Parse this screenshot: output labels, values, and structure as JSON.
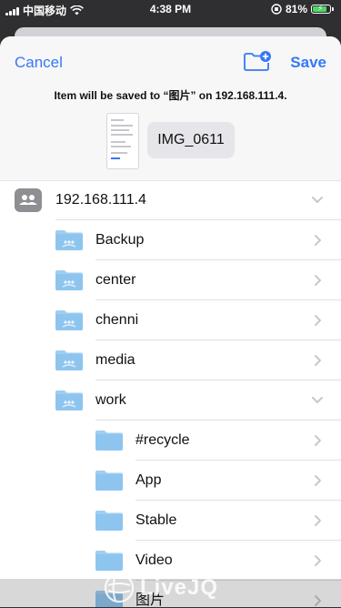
{
  "status_bar": {
    "carrier": "中国移动",
    "time": "4:38 PM",
    "battery_percent": "81%"
  },
  "header": {
    "cancel_label": "Cancel",
    "save_label": "Save",
    "save_message": "Item will be saved to “图片” on 192.168.111.4.",
    "file_name": "IMG_0611"
  },
  "server": {
    "name": "192.168.111.4"
  },
  "folders": [
    {
      "name": "Backup",
      "level": 1,
      "expanded": false
    },
    {
      "name": "center",
      "level": 1,
      "expanded": false
    },
    {
      "name": "chenni",
      "level": 1,
      "expanded": false
    },
    {
      "name": "media",
      "level": 1,
      "expanded": false
    },
    {
      "name": "work",
      "level": 1,
      "expanded": true
    },
    {
      "name": "#recycle",
      "level": 2,
      "expanded": false
    },
    {
      "name": "App",
      "level": 2,
      "expanded": false
    },
    {
      "name": "Stable",
      "level": 2,
      "expanded": false
    },
    {
      "name": "Video",
      "level": 2,
      "expanded": false
    },
    {
      "name": "图片",
      "level": 2,
      "expanded": false
    }
  ],
  "watermark": {
    "text": "LiveJQ"
  },
  "colors": {
    "accent": "#3478f6",
    "folder": "#8ec5ef",
    "separator": "#e0e0e5"
  }
}
